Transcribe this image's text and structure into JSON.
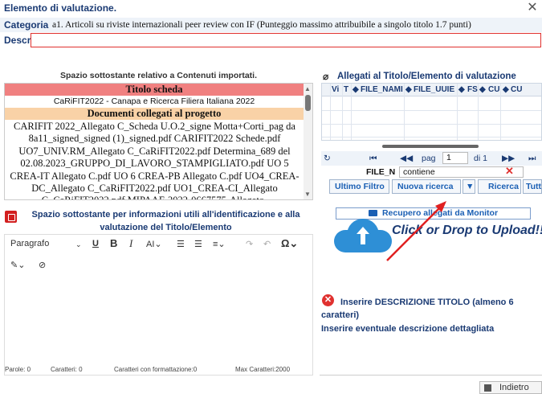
{
  "window": {
    "title": "Elemento di valutazione.",
    "close": "✕"
  },
  "categoria": {
    "label": "Categoria",
    "value": "a1. Articoli su riviste internazionali peer review con IF (Punteggio massimo attribuibile a singolo titolo 1.7 punti)"
  },
  "descr": {
    "label": "Descr.",
    "value": ""
  },
  "contenuti": {
    "heading": "Spazio sottostante relativo a Contenuti importati.",
    "titolo_scheda": "Titolo scheda",
    "titolo_value": "CaRiFIT2022 - Canapa e Ricerca Filiera Italiana 2022",
    "documenti": "Documenti collegati al progetto",
    "body": "CARIFIT 2022_Allegato C_Scheda U.O.2_signe Motta+Corti_pag da 8a11_signed_signed (1)_signed.pdf CARIFIT2022 Schede.pdf UO7_UNIV.RM_Allegato C_CaRiFIT2022.pdf Determina_689 del 02.08.2023_GRUPPO_DI_LAVORO_STAMPIGLIATO.pdf UO 5 CREA-IT Allegato C.pdf UO 6 CREA-PB Allegato C.pdf UO4_CREA-DC_Allegato C_CaRiFIT2022.pdf UO1_CREA-CI_Allegato C_CaRiFIT2022.pdf MIPAAF-2022-0667575-Allegato-"
  },
  "info": {
    "heading": "Spazio sottostante per informazioni utili all'identificazione e alla valutazione del Titolo/Elemento"
  },
  "editor": {
    "paragraph": "Paragrafo",
    "status": {
      "parole": "Parole: 0",
      "caratteri": "Caratteri: 0",
      "formattazione": "Caratteri con formattazione:0",
      "max": "Max Caratteri:2000"
    }
  },
  "allegati": {
    "heading": "Allegati al Titolo/Elemento di valutazione",
    "columns": [
      "Vi",
      "T",
      "FILE_NAMI",
      "FILE_UUIE",
      "FS",
      "CU",
      "CU"
    ],
    "pager": {
      "page_label": "pag",
      "page_value": "1",
      "of_label": "di 1"
    },
    "filter": {
      "field": "FILE_N",
      "value": "contiene"
    },
    "buttons": {
      "ultimo": "Ultimo Filtro",
      "nuova": "Nuova ricerca",
      "ricerca": "Ricerca",
      "tutte": "Tutte"
    }
  },
  "upload": {
    "recupero": "Recupero allegati da Monitor",
    "drop": "Click or Drop to Upload!!"
  },
  "errors": {
    "line1": "Inserire DESCRIZIONE TITOLO (almeno 6 caratteri)",
    "line2": "Inserire eventuale descrizione dettagliata"
  },
  "footer": {
    "indietro": "Indietro"
  }
}
